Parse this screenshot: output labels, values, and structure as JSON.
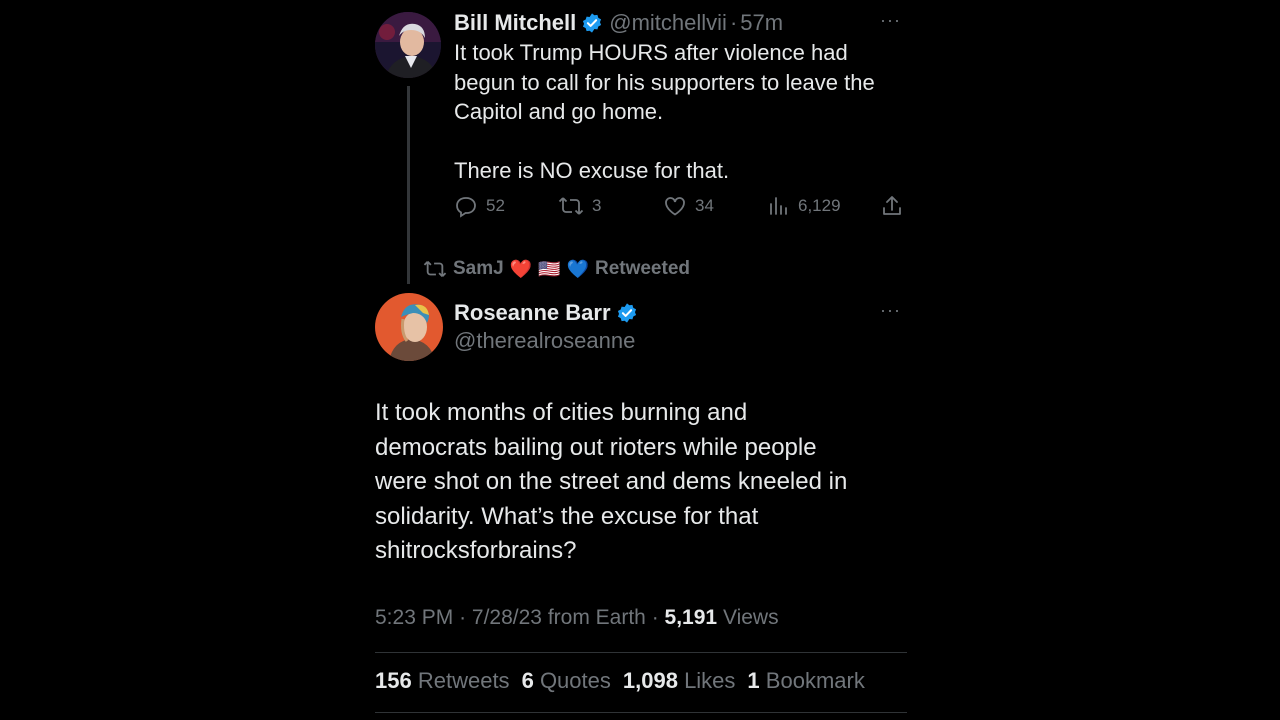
{
  "quoted_tweet": {
    "author_name": "Bill Mitchell",
    "handle": "@mitchellvii",
    "separator": "·",
    "time": "57m",
    "more": "···",
    "lines": [
      "It took Trump HOURS after violence had",
      "begun to call for his supporters to leave the",
      "Capitol and go home.",
      "",
      "There is NO excuse for that."
    ],
    "actions": {
      "replies": "52",
      "retweets": "3",
      "likes": "34",
      "views": "6,129"
    }
  },
  "retweet_banner": {
    "user": "SamJ",
    "emojis": [
      "❤️",
      "🇺🇸",
      "💙"
    ],
    "label": "Retweeted"
  },
  "main_tweet": {
    "author_name": "Roseanne Barr",
    "handle": "@therealroseanne",
    "more": "···",
    "lines": [
      "It took months of cities burning and",
      "democrats bailing out rioters while people",
      "were shot on the street and dems kneeled in",
      "solidarity. What’s the excuse for that",
      "shitrocksforbrains?"
    ],
    "meta": {
      "time": "5:23 PM",
      "date": "7/28/23",
      "source": "from Earth",
      "views_count": "5,191",
      "views_label": "Views",
      "separator": "·"
    },
    "stats": {
      "retweets_count": "156",
      "retweets_label": "Retweets",
      "quotes_count": "6",
      "quotes_label": "Quotes",
      "likes_count": "1,098",
      "likes_label": "Likes",
      "bookmarks_count": "1",
      "bookmarks_label": "Bookmark"
    }
  },
  "colors": {
    "background": "#000000",
    "text": "#e7e9ea",
    "muted": "#71767b",
    "verified": "#1d9bf0",
    "divider": "#2f3336"
  }
}
